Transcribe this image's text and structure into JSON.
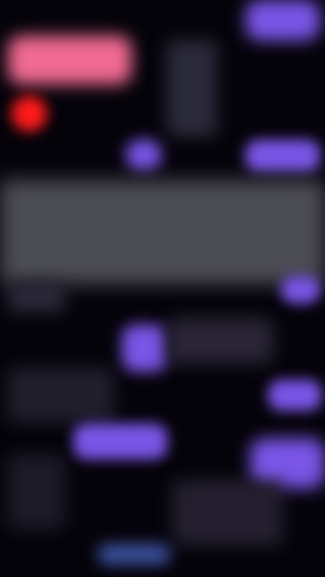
{
  "top": {
    "brand": "",
    "profile": "",
    "action_label": ""
  },
  "hero": {
    "title": "",
    "subtitle": "",
    "cta_label": ""
  },
  "nav": {
    "pill_labels": [
      "",
      "",
      ""
    ]
  },
  "sections": [
    {
      "label": ""
    },
    {
      "label": ""
    },
    {
      "label": ""
    }
  ],
  "colors": {
    "background": "#05030a",
    "accent": "#7a55e6",
    "pink": "#f06a93",
    "red": "#ff1b1b",
    "grey_panel": "#4c4c54"
  }
}
